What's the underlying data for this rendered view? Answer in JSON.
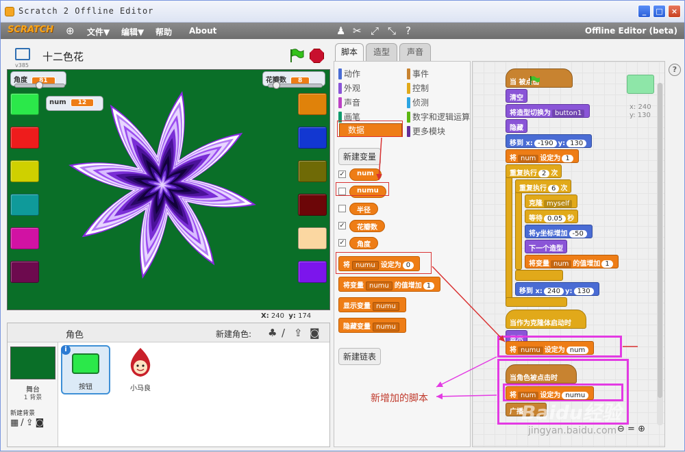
{
  "window": {
    "title": "Scratch 2 Offline Editor"
  },
  "menu": {
    "logo": "SCRATCH",
    "file": "文件▼",
    "edit": "编辑▼",
    "help": "帮助",
    "about": "About",
    "mode": "Offline Editor (beta)"
  },
  "stage": {
    "version": "v385",
    "project_title": "十二色花",
    "monitors": {
      "angle_label": "角度",
      "angle_value": "81",
      "petals_label": "花瓣数",
      "petals_value": "8",
      "num_label": "num",
      "num_value": "12"
    },
    "coords": {
      "x_label": "X:",
      "x_value": "240",
      "y_label": "y:",
      "y_value": "174"
    },
    "swatches_left": [
      "#2be84a",
      "#ee1c1c",
      "#cfd000",
      "#0f9a9a",
      "#d112a3",
      "#6d0a4e"
    ],
    "swatches_right": [
      "#e0820a",
      "#1237d1",
      "#6f6a06",
      "#6c0608",
      "#fbd7a1",
      "#7c15ec"
    ]
  },
  "sprites": {
    "header": "角色",
    "new_sprite": "新建角色:",
    "stage_label": "舞台",
    "stage_backdrops": "1 背景",
    "new_backdrop": "新建背景",
    "items": [
      {
        "name": "按钮"
      },
      {
        "name": "小马良"
      }
    ]
  },
  "tabs": [
    "脚本",
    "造型",
    "声音"
  ],
  "palette": {
    "categories_left": [
      "动作",
      "外观",
      "声音",
      "画笔",
      "数据"
    ],
    "categories_right": [
      "事件",
      "控制",
      "侦测",
      "数字和逻辑运算",
      "更多模块"
    ],
    "cat_colors_left": [
      "#4a6cd4",
      "#8a55d7",
      "#bb42c3",
      "#0e9a6c",
      "#ee7d16"
    ],
    "cat_colors_right": [
      "#c88330",
      "#e1a91a",
      "#2ca5e2",
      "#5cb712",
      "#632d99"
    ],
    "new_variable": "新建变量",
    "variables": [
      "num",
      "numu",
      "半径",
      "花瓣数",
      "角度"
    ],
    "var_checked": [
      true,
      false,
      false,
      true,
      true
    ],
    "set_block": {
      "a": "将",
      "var": "numu",
      "b": "设定为",
      "val": "0"
    },
    "change_block": {
      "a": "将变量",
      "var": "numu",
      "b": "的值增加",
      "val": "1"
    },
    "show_block": {
      "a": "显示变量",
      "var": "numu"
    },
    "hide_block": {
      "a": "隐藏变量",
      "var": "numu"
    },
    "new_list": "新建链表"
  },
  "scripts": {
    "hat1": "当      被点击",
    "clear": "清空",
    "costume": "将造型切换为",
    "costume_val": "button1",
    "hide": "隐藏",
    "goto1_a": "移到 x:",
    "goto1_x": "-190",
    "goto1_b": "y:",
    "goto1_y": "130",
    "setnum_a": "将",
    "setnum_var": "num",
    "setnum_b": "设定为",
    "setnum_val": "1",
    "repeat1": "重复执行",
    "repeat1_n": "2",
    "repeat1_b": "次",
    "repeat2": "重复执行",
    "repeat2_n": "6",
    "repeat2_b": "次",
    "clone": "克隆",
    "clone_val": "myself",
    "wait_a": "等待",
    "wait_val": "0.05",
    "wait_b": "秒",
    "changey_a": "将y坐标增加",
    "changey_val": "-50",
    "next_costume": "下一个造型",
    "changenum_a": "将变量",
    "changenum_var": "num",
    "changenum_b": "的值增加",
    "changenum_val": "1",
    "goto2_a": "移到 x:",
    "goto2_x": "240",
    "goto2_b": "y:",
    "goto2_y": "130",
    "hat2": "当作为克隆体启动时",
    "show": "显示",
    "setnumu_a": "将",
    "setnumu_var": "numu",
    "setnumu_b": "设定为",
    "setnumu_val": "num",
    "hat3": "当角色被点击时",
    "setnum2_a": "将",
    "setnum2_var": "num",
    "setnum2_b": "设定为",
    "setnum2_val": "numu",
    "broadcast": "广播",
    "sprite_x": "x: 240",
    "sprite_y": "y: 130"
  },
  "annotation": "新增加的脚本",
  "watermark": "Baidu经验",
  "watermark_url": "jingyan.baidu.com"
}
